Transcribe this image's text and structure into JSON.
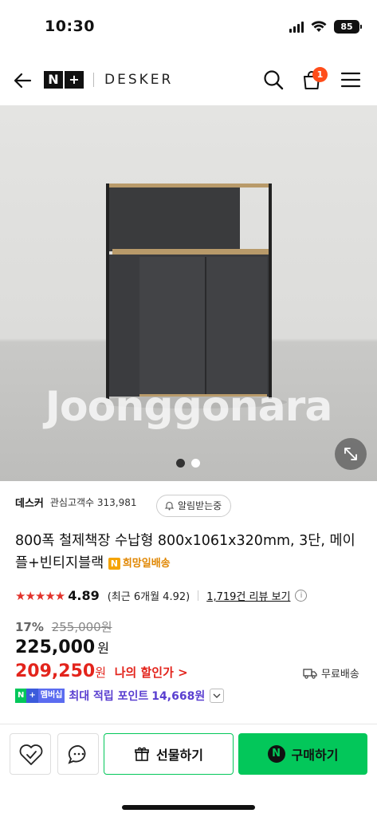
{
  "status": {
    "time": "10:30",
    "battery": "85"
  },
  "header": {
    "logo_n": "N",
    "logo_plus": "+",
    "brand_name": "DESKER",
    "cart_count": "1"
  },
  "hero": {
    "watermark": "Joonggonara",
    "slide_count": 2,
    "active_slide": 1
  },
  "product": {
    "brand": "데스커",
    "interest": "관심고객수 313,981",
    "alarm_label": "알림받는중",
    "title": "800폭 철제책장 수납형 800x1061x320mm, 3단, 메이플+빈티지블랙",
    "delivery_badge": "희망일배송",
    "rating": "4.89",
    "recent_rating": "(최근 6개월 4.92)",
    "review_link": "1,719건 리뷰 보기",
    "discount": "17%",
    "original_price": "255,000원",
    "price": "225,000",
    "price_unit": "원",
    "my_price": "209,250",
    "my_price_unit": "원",
    "my_price_label": "나의 할인가 >",
    "shipping": "무료배송",
    "member_badge": [
      "N",
      "+",
      "멤버십"
    ],
    "points_label": "최대 적립 포인트",
    "points_amount": "14,668원"
  },
  "bottom": {
    "gift_label": "선물하기",
    "buy_label": "구매하기"
  },
  "colors": {
    "naver_green": "#03c75a",
    "sale_red": "#e3241c",
    "points_purple": "#5a3fd0",
    "badge_orange": "#ff4d1a"
  }
}
